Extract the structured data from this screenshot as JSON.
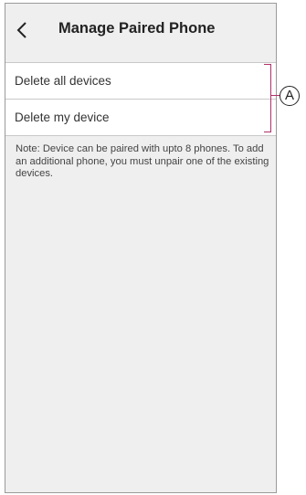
{
  "header": {
    "title": "Manage Paired Phone",
    "back_icon": "chevron-left-icon"
  },
  "items": [
    {
      "label": "Delete all devices"
    },
    {
      "label": "Delete my device"
    }
  ],
  "note": "Note: Device can be paired with upto 8 phones. To add an additional phone, you must unpair one of the existing devices.",
  "callout": {
    "label": "A",
    "color": "#b0306a"
  }
}
